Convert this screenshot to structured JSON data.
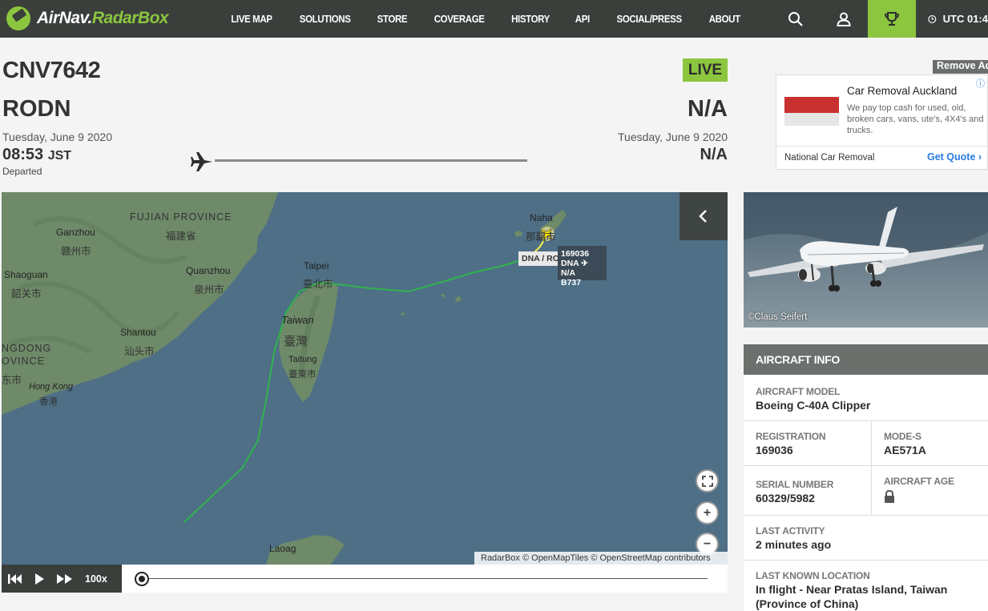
{
  "nav": {
    "logo_primary": "AirNav.",
    "logo_secondary": "RadarBox",
    "items": [
      "LIVE MAP",
      "SOLUTIONS",
      "STORE",
      "COVERAGE",
      "HISTORY",
      "API",
      "SOCIAL/PRESS",
      "ABOUT"
    ],
    "utc_label": "UTC 01:4"
  },
  "flight": {
    "callsign": "CNV7642",
    "status_badge": "LIVE",
    "origin": {
      "code": "RODN",
      "date": "Tuesday, June 9 2020",
      "time": "08:53",
      "tz": "JST",
      "status": "Departed"
    },
    "destination": {
      "code": "N/A",
      "date": "Tuesday, June 9 2020",
      "time": "N/A"
    }
  },
  "ad": {
    "remove_label": "Remove Ad",
    "title": "Car Removal Auckland",
    "description": "We pay top cash for used, old, broken cars, vans, ute's, 4X4's and trucks.",
    "advertiser": "National Car Removal",
    "cta": "Get Quote"
  },
  "map": {
    "labels": {
      "ganzhou": "Ganzhou",
      "ganzhou_zh": "赣州市",
      "fujian": "FUJIAN PROVINCE",
      "fujian_zh": "福建省",
      "quanzhou": "Quanzhou",
      "quanzhou_zh": "泉州市",
      "shaoguan": "Shaoguan",
      "shaoguan_zh": "韶关市",
      "shantou": "Shantou",
      "shantou_zh": "汕头市",
      "guangdong": "NGDONG",
      "province": "OVINCE",
      "dongguan_zh": "东市",
      "hongkong": "Hong Kong",
      "hongkong_zh": "香港",
      "taipei": "Taipei",
      "taipei_zh": "臺北市",
      "taiwan": "Taiwan",
      "taiwan_zh": "臺灣",
      "taitung": "Taitung",
      "taitung_zh": "臺東市",
      "naha": "Naha",
      "naha_zh": "那覇市",
      "laoag": "Laoag"
    },
    "flight_tag": [
      "169036",
      "DNA ✈ N/A",
      "B737"
    ],
    "route_tag": "DNA / RODN",
    "attribution": "RadarBox © OpenMapTiles © OpenStreetMap contributors",
    "colors": {
      "sea": "#4e6f86",
      "land": "#6e8a68",
      "track": "#2fb34d",
      "track_end": "#e8e84a"
    }
  },
  "playback": {
    "speed": "100x",
    "progress": 0.0
  },
  "photo": {
    "credit": "©Claus Seifert"
  },
  "aircraft_info": {
    "header": "AIRCRAFT INFO",
    "model_label": "AIRCRAFT MODEL",
    "model_value": "Boeing C-40A Clipper",
    "registration_label": "REGISTRATION",
    "registration_value": "169036",
    "modes_label": "MODE-S",
    "modes_value": "AE571A",
    "serial_label": "SERIAL NUMBER",
    "serial_value": "60329/5982",
    "age_label": "AIRCRAFT AGE",
    "age_icon": "lock-icon",
    "activity_label": "LAST ACTIVITY",
    "activity_value": "2 minutes ago",
    "location_label": "LAST KNOWN LOCATION",
    "location_value": "In flight - Near Pratas Island, Taiwan (Province of China)"
  },
  "colors": {
    "brand_green": "#8cc63f",
    "nav_bg": "#3a3f3c",
    "panel_header": "#6b706d"
  }
}
